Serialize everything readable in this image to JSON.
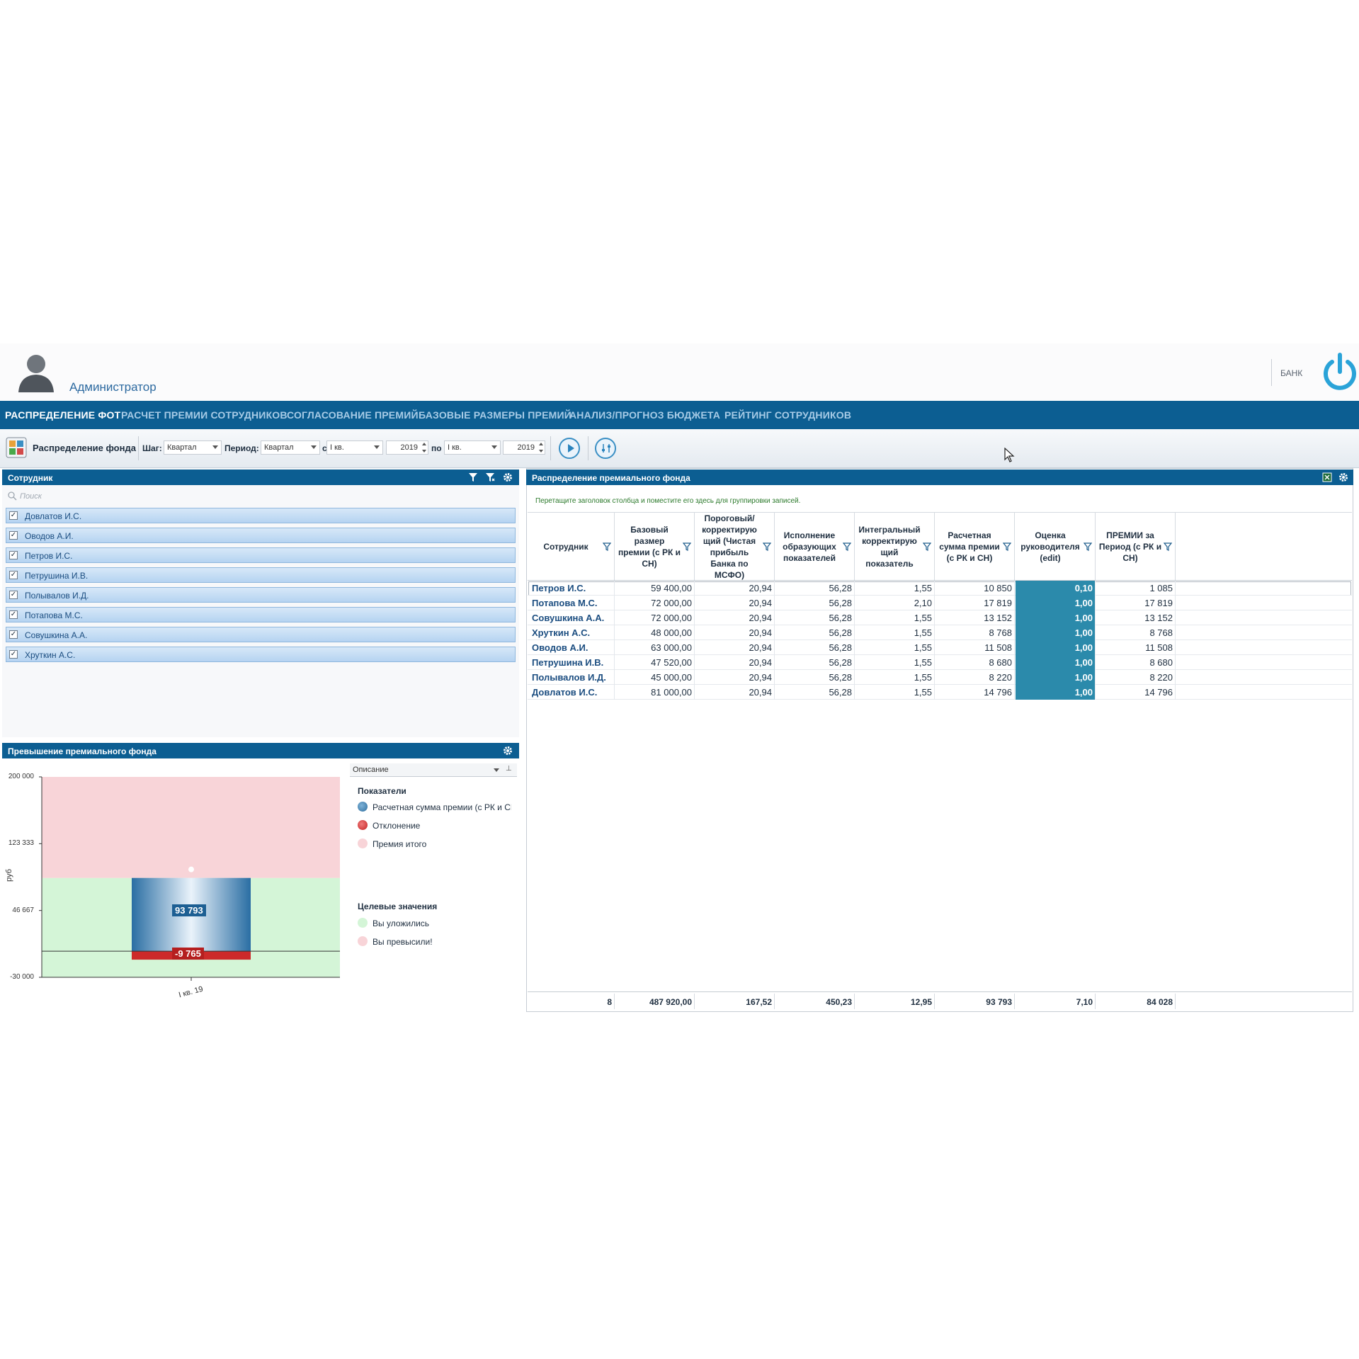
{
  "header": {
    "username": "Администратор",
    "org": "БАНК"
  },
  "nav": {
    "items": [
      {
        "label": "РАСПРЕДЕЛЕНИЕ ФОТ",
        "active": true
      },
      {
        "label": "РАСЧЕТ ПРЕМИИ СОТРУДНИКОВ",
        "active": false
      },
      {
        "label": "СОГЛАСОВАНИЕ ПРЕМИЙ",
        "active": false
      },
      {
        "label": "БАЗОВЫЕ РАЗМЕРЫ ПРЕМИЙ",
        "active": false
      },
      {
        "label": "АНАЛИЗ/ПРОГНОЗ БЮДЖЕТА",
        "active": false
      },
      {
        "label": "РЕЙТИНГ СОТРУДНИКОВ",
        "active": false
      }
    ]
  },
  "toolbar": {
    "title": "Распределение фонда",
    "step_label": "Шаг:",
    "step_value": "Квартал",
    "period_label": "Период:",
    "period_value": "Квартал",
    "from_label": "с",
    "from_quarter": "I кв.",
    "from_year": "2019",
    "to_label": "по",
    "to_quarter": "I кв.",
    "to_year": "2019"
  },
  "employees": {
    "title": "Сотрудник",
    "search_placeholder": "Поиск",
    "items": [
      "Довлатов И.С.",
      "Оводов А.И.",
      "Петров И.С.",
      "Петрушина И.В.",
      "Полывалов И.Д.",
      "Потапова М.С.",
      "Совушкина А.А.",
      "Хруткин А.С."
    ]
  },
  "chart_panel": {
    "title": "Превышение премиального фонда",
    "legend_dropdown": "Описание",
    "legend_group1": "Показатели",
    "legend_items1": [
      "Расчетная сумма премии (с РК и СН",
      "Отклонение",
      "Премия итого"
    ],
    "legend_group2": "Целевые значения",
    "legend_items2": [
      "Вы уложились",
      "Вы превысили!"
    ],
    "colors": {
      "bar": "#2f7bb0",
      "deviation": "#cc2a2a",
      "over_zone": "#f8d4d8",
      "ok_zone": "#d4f5d7"
    }
  },
  "chart_data": {
    "type": "bar",
    "categories": [
      "I кв. 19"
    ],
    "series": [
      {
        "name": "Расчетная сумма премии (с РК и СН",
        "values": [
          93793
        ]
      },
      {
        "name": "Отклонение",
        "values": [
          -9765
        ]
      },
      {
        "name": "Премия итого",
        "values": [
          84028
        ]
      }
    ],
    "ylabel": "руб",
    "yticks": [
      "200 000",
      "123 333",
      "46 667",
      "-30 000"
    ],
    "ylim": [
      -30000,
      200000
    ],
    "target_zones": [
      {
        "name": "Вы уложились",
        "from": -30000,
        "to": 84028
      },
      {
        "name": "Вы превысили!",
        "from": 84028,
        "to": 200000
      }
    ],
    "data_labels": [
      "93 793",
      "-9 765"
    ]
  },
  "grid": {
    "title": "Распределение премиального фонда",
    "group_hint": "Перетащите заголовок столбца и поместите его здесь для группировки записей.",
    "columns": [
      "Сотрудник",
      "Базовый размер премии (с РК и СН)",
      "Пороговый/ корректирую щий (Чистая прибыль Банка по МСФО)",
      "Исполнение образующих показателей",
      "Интегральный корректирую щий показатель",
      "Расчетная сумма премии (с РК и СН)",
      "Оценка руководителя (edit)",
      "ПРЕМИИ за Период (с РК и СН)"
    ],
    "rows": [
      [
        "Петров И.С.",
        "59 400,00",
        "20,94",
        "56,28",
        "1,55",
        "10 850",
        "0,10",
        "1 085"
      ],
      [
        "Потапова М.С.",
        "72 000,00",
        "20,94",
        "56,28",
        "2,10",
        "17 819",
        "1,00",
        "17 819"
      ],
      [
        "Совушкина А.А.",
        "72 000,00",
        "20,94",
        "56,28",
        "1,55",
        "13 152",
        "1,00",
        "13 152"
      ],
      [
        "Хруткин А.С.",
        "48 000,00",
        "20,94",
        "56,28",
        "1,55",
        "8 768",
        "1,00",
        "8 768"
      ],
      [
        "Оводов А.И.",
        "63 000,00",
        "20,94",
        "56,28",
        "1,55",
        "11 508",
        "1,00",
        "11 508"
      ],
      [
        "Петрушина И.В.",
        "47 520,00",
        "20,94",
        "56,28",
        "1,55",
        "8 680",
        "1,00",
        "8 680"
      ],
      [
        "Полывалов И.Д.",
        "45 000,00",
        "20,94",
        "56,28",
        "1,55",
        "8 220",
        "1,00",
        "8 220"
      ],
      [
        "Довлатов И.С.",
        "81 000,00",
        "20,94",
        "56,28",
        "1,55",
        "14 796",
        "1,00",
        "14 796"
      ]
    ],
    "footer": [
      "8",
      "487 920,00",
      "167,52",
      "450,23",
      "12,95",
      "93 793",
      "7,10",
      "84 028"
    ]
  }
}
